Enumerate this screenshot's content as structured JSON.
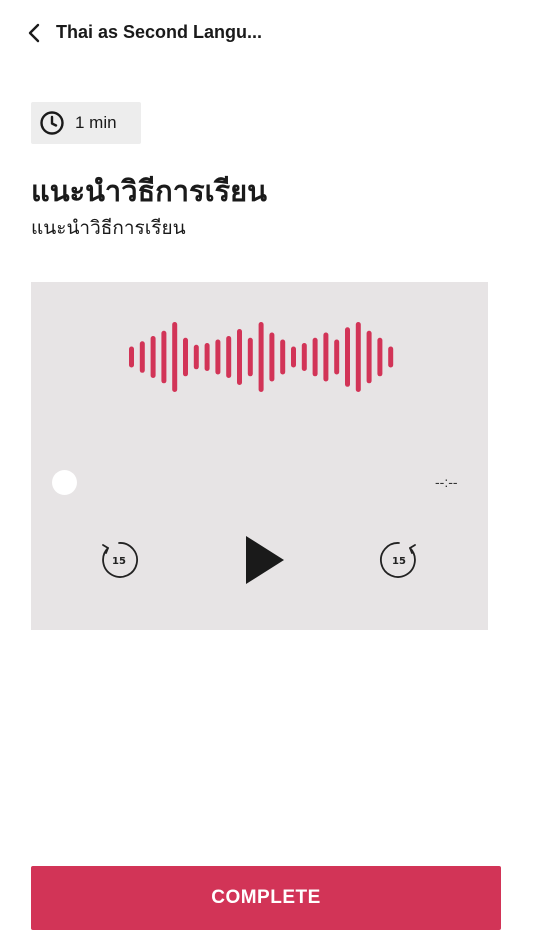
{
  "header": {
    "title": "Thai as Second Langu..."
  },
  "lesson": {
    "duration": "1 min",
    "title": "แนะนำวิธีการเรียน",
    "subtitle": "แนะนำวิธีการเรียน"
  },
  "player": {
    "time_remaining": "--:--",
    "progress": 0,
    "skip_back_seconds": "15",
    "skip_forward_seconds": "15",
    "state": "paused",
    "waveform_levels": [
      0.3,
      0.45,
      0.6,
      0.75,
      1.0,
      0.55,
      0.35,
      0.4,
      0.5,
      0.6,
      0.8,
      0.55,
      1.0,
      0.7,
      0.5,
      0.3,
      0.4,
      0.55,
      0.7,
      0.5,
      0.85,
      1.0,
      0.75,
      0.55,
      0.3
    ]
  },
  "actions": {
    "complete_label": "COMPLETE"
  },
  "colors": {
    "accent": "#d23457",
    "player_bg": "#e7e4e5",
    "chip_bg": "#ededed",
    "waveform": "#d23457"
  },
  "icons": {
    "back": "chevron-left-icon",
    "duration": "clock-icon",
    "rewind": "rewind-15-icon",
    "play": "play-icon",
    "forward": "forward-15-icon"
  }
}
